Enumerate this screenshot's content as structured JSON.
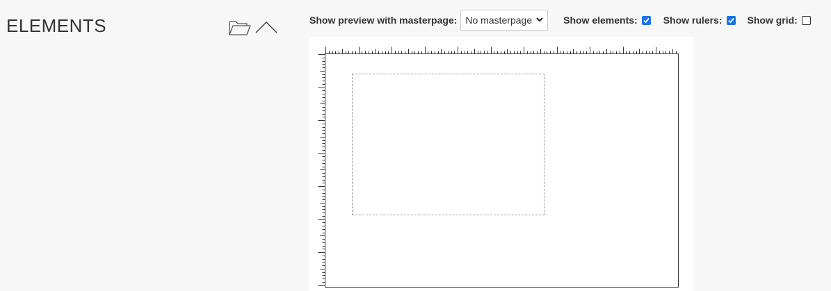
{
  "panel": {
    "title": "ELEMENTS",
    "icons": [
      "folder-open-icon",
      "chevron-up-icon"
    ]
  },
  "toolbar": {
    "masterpage_label": "Show preview with masterpage:",
    "masterpage_value": "No masterpage",
    "show_elements_label": "Show elements:",
    "show_elements_checked": true,
    "show_rulers_label": "Show rulers:",
    "show_rulers_checked": true,
    "show_grid_label": "Show grid:",
    "show_grid_checked": false
  },
  "colors": {
    "checkbox_accent": "#1a73e8",
    "background": "#f7f7f7"
  }
}
